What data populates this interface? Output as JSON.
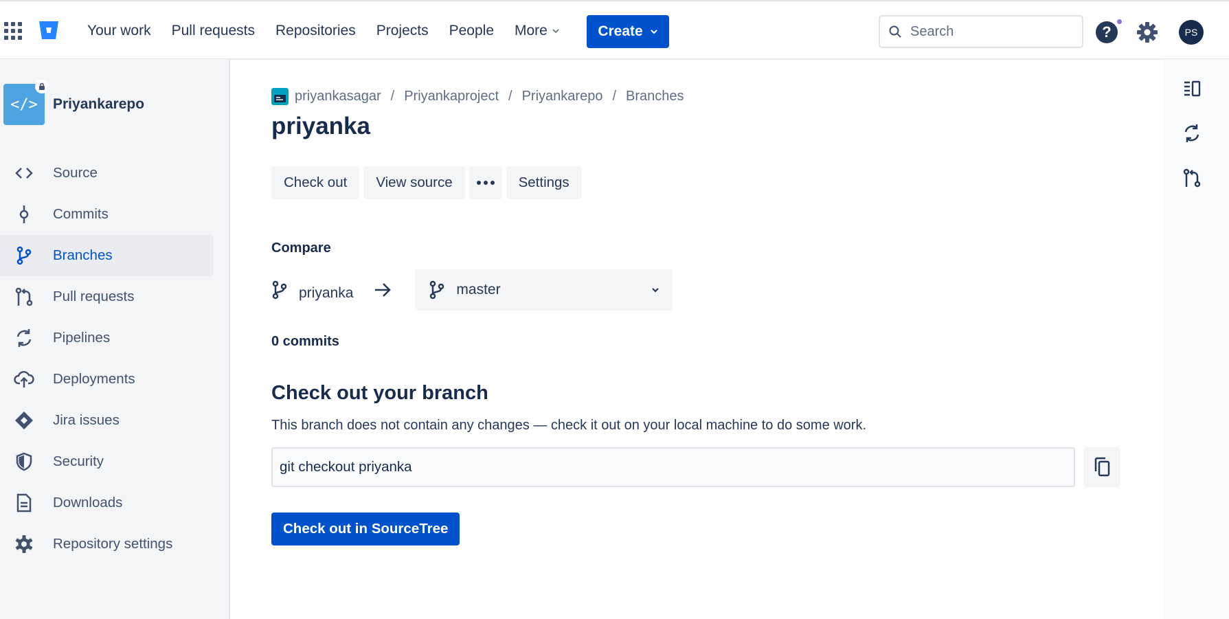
{
  "topnav": {
    "items": [
      {
        "label": "Your work"
      },
      {
        "label": "Pull requests"
      },
      {
        "label": "Repositories"
      },
      {
        "label": "Projects"
      },
      {
        "label": "People"
      },
      {
        "label": "More"
      }
    ],
    "create_label": "Create",
    "search_placeholder": "Search",
    "help_symbol": "?",
    "avatar_initials": "PS",
    "icons": [
      "app-switcher-icon",
      "bitbucket-logo",
      "search-icon",
      "help-icon",
      "settings-gear-icon"
    ]
  },
  "sidebar": {
    "repo_name": "Priyankarepo",
    "repo_icon_glyph": "</>",
    "items": [
      {
        "label": "Source",
        "icon": "source-code-icon"
      },
      {
        "label": "Commits",
        "icon": "commit-icon"
      },
      {
        "label": "Branches",
        "icon": "branch-icon",
        "active": true
      },
      {
        "label": "Pull requests",
        "icon": "pull-request-icon"
      },
      {
        "label": "Pipelines",
        "icon": "pipelines-icon"
      },
      {
        "label": "Deployments",
        "icon": "deployments-cloud-icon"
      },
      {
        "label": "Jira issues",
        "icon": "jira-icon"
      },
      {
        "label": "Security",
        "icon": "shield-icon"
      },
      {
        "label": "Downloads",
        "icon": "document-icon"
      },
      {
        "label": "Repository settings",
        "icon": "gear-icon"
      }
    ]
  },
  "breadcrumb": {
    "items": [
      "priyankasagar",
      "Priyankaproject",
      "Priyankarepo",
      "Branches"
    ],
    "separator": "/"
  },
  "page": {
    "title": "priyanka",
    "actions": {
      "checkout": "Check out",
      "view_source": "View source",
      "more": "•••",
      "settings": "Settings"
    },
    "compare": {
      "label": "Compare",
      "source_branch": "priyanka",
      "destination_branch": "master"
    },
    "commits_count": "0 commits",
    "checkout_section": {
      "title": "Check out your branch",
      "description": "This branch does not contain any changes — check it out on your local machine to do some work.",
      "command": "git checkout priyanka",
      "sourcetree_button": "Check out in SourceTree"
    }
  },
  "right_rail": {
    "icons": [
      "sidebar-panel-icon",
      "pipelines-sync-icon",
      "pull-request-icon"
    ]
  },
  "colors": {
    "brand_blue": "#0052cc",
    "text_dark": "#172b4d",
    "text_muted": "#42526e",
    "sidebar_bg": "#f4f5f7",
    "help_dot": "#8777d9",
    "repo_icon_bg": "#4fa3e0"
  }
}
